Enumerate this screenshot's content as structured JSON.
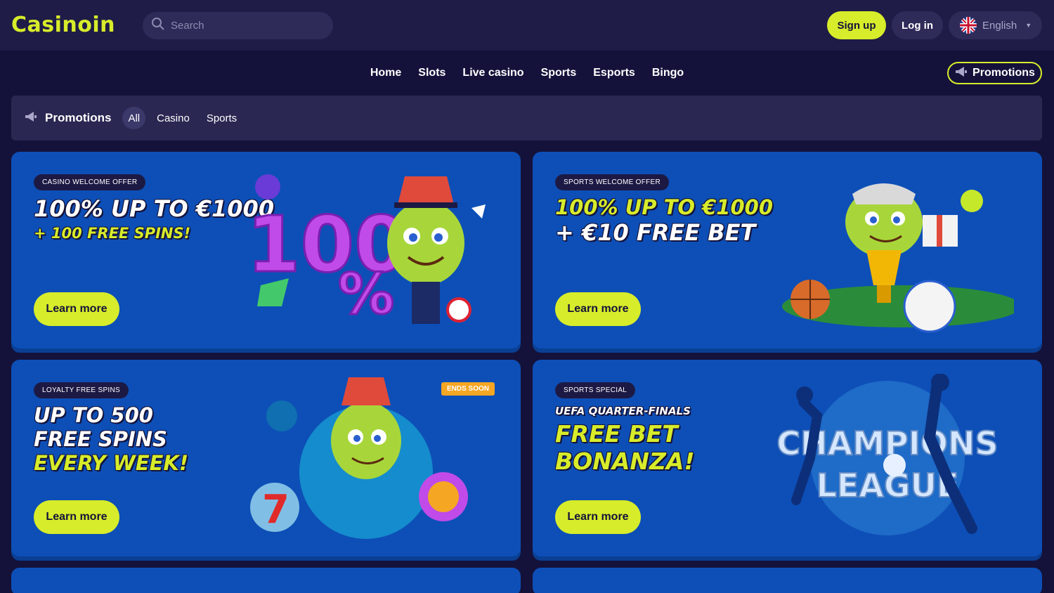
{
  "header": {
    "logo": "Casinoin",
    "search_placeholder": "Search",
    "signup_label": "Sign up",
    "login_label": "Log in",
    "language": "English"
  },
  "nav": {
    "items": [
      "Home",
      "Slots",
      "Live casino",
      "Sports",
      "Esports",
      "Bingo"
    ],
    "promotions_label": "Promotions"
  },
  "filter": {
    "title": "Promotions",
    "chips": [
      "All",
      "Casino",
      "Sports"
    ],
    "active": "All"
  },
  "cards": [
    {
      "tag": "Casino welcome offer",
      "lines": [
        "100% UP TO €1000",
        "+ 100 FREE SPINS!"
      ],
      "button": "Learn more"
    },
    {
      "tag": "Sports welcome offer",
      "lines": [
        "100% UP TO €1000",
        "+ €10 FREE BET"
      ],
      "button": "Learn more"
    },
    {
      "tag": "Loyalty free spins",
      "badge": "ENDS SOON",
      "lines": [
        "UP TO 500",
        "FREE SPINS",
        "EVERY WEEK!"
      ],
      "button": "Learn more"
    },
    {
      "tag": "Sports special",
      "lines": [
        "UEFA QUARTER-FINALS",
        "FREE BET",
        "BONANZA!"
      ],
      "art_text": "CHAMPIONS LEAGUE",
      "button": "Learn more"
    }
  ],
  "colors": {
    "background": "#14123a",
    "header": "#1f1c47",
    "accent": "#d7ec2a",
    "card": "#0d4fb7",
    "badge": "#f5a623"
  }
}
